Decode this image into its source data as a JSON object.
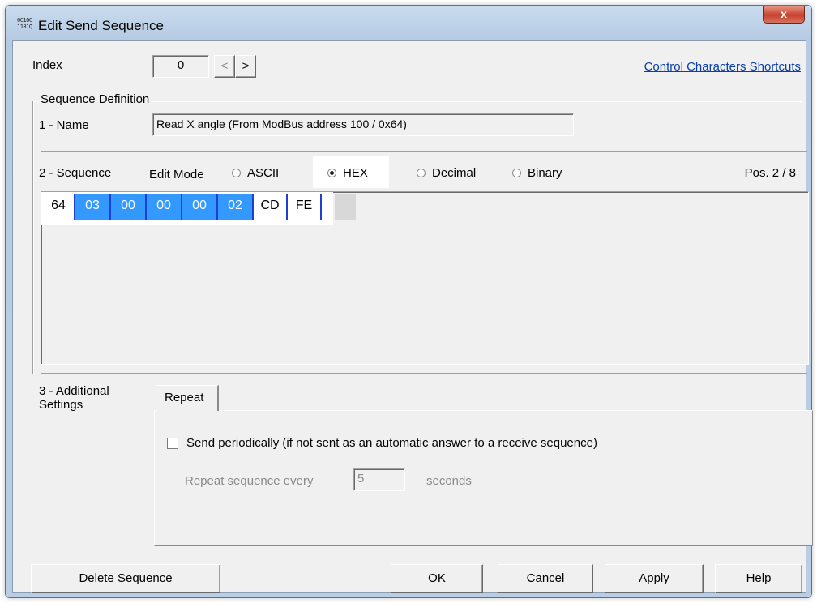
{
  "window": {
    "title": "Edit Send Sequence",
    "icon_text": "0C10C\n1181Q",
    "close_label": "x"
  },
  "index": {
    "label": "Index",
    "value": "0",
    "prev_label": "<",
    "next_label": ">"
  },
  "shortcuts_link": "Control Characters Shortcuts",
  "definition": {
    "group_label": "Sequence Definition",
    "name_label": "1 - Name",
    "name_value": "Read X angle (From ModBus address 100 / 0x64)"
  },
  "sequence": {
    "label": "2 - Sequence",
    "edit_mode_label": "Edit Mode",
    "modes": [
      {
        "label": "ASCII",
        "selected": false
      },
      {
        "label": "HEX",
        "selected": true
      },
      {
        "label": "Decimal",
        "selected": false
      },
      {
        "label": "Binary",
        "selected": false
      }
    ],
    "position": "Pos. 2 / 8",
    "bytes": [
      {
        "value": "64",
        "selected": false
      },
      {
        "value": "03",
        "selected": true
      },
      {
        "value": "00",
        "selected": true
      },
      {
        "value": "00",
        "selected": true
      },
      {
        "value": "00",
        "selected": true
      },
      {
        "value": "02",
        "selected": true
      },
      {
        "value": "CD",
        "selected": false
      },
      {
        "value": "FE",
        "selected": false
      }
    ]
  },
  "additional": {
    "label_line1": "3 - Additional",
    "label_line2": "Settings",
    "tab_label": "Repeat",
    "send_periodically_label": "Send periodically  (if not sent as an automatic answer to a receive sequence)",
    "send_periodically_checked": false,
    "repeat_label": "Repeat sequence every",
    "repeat_value": "5",
    "repeat_unit": "seconds"
  },
  "buttons": {
    "delete": "Delete Sequence",
    "ok": "OK",
    "cancel": "Cancel",
    "apply": "Apply",
    "help": "Help"
  },
  "colors": {
    "selection": "#3399ff",
    "link": "#0b3fa8",
    "byte_divider": "#1e3fd6"
  }
}
